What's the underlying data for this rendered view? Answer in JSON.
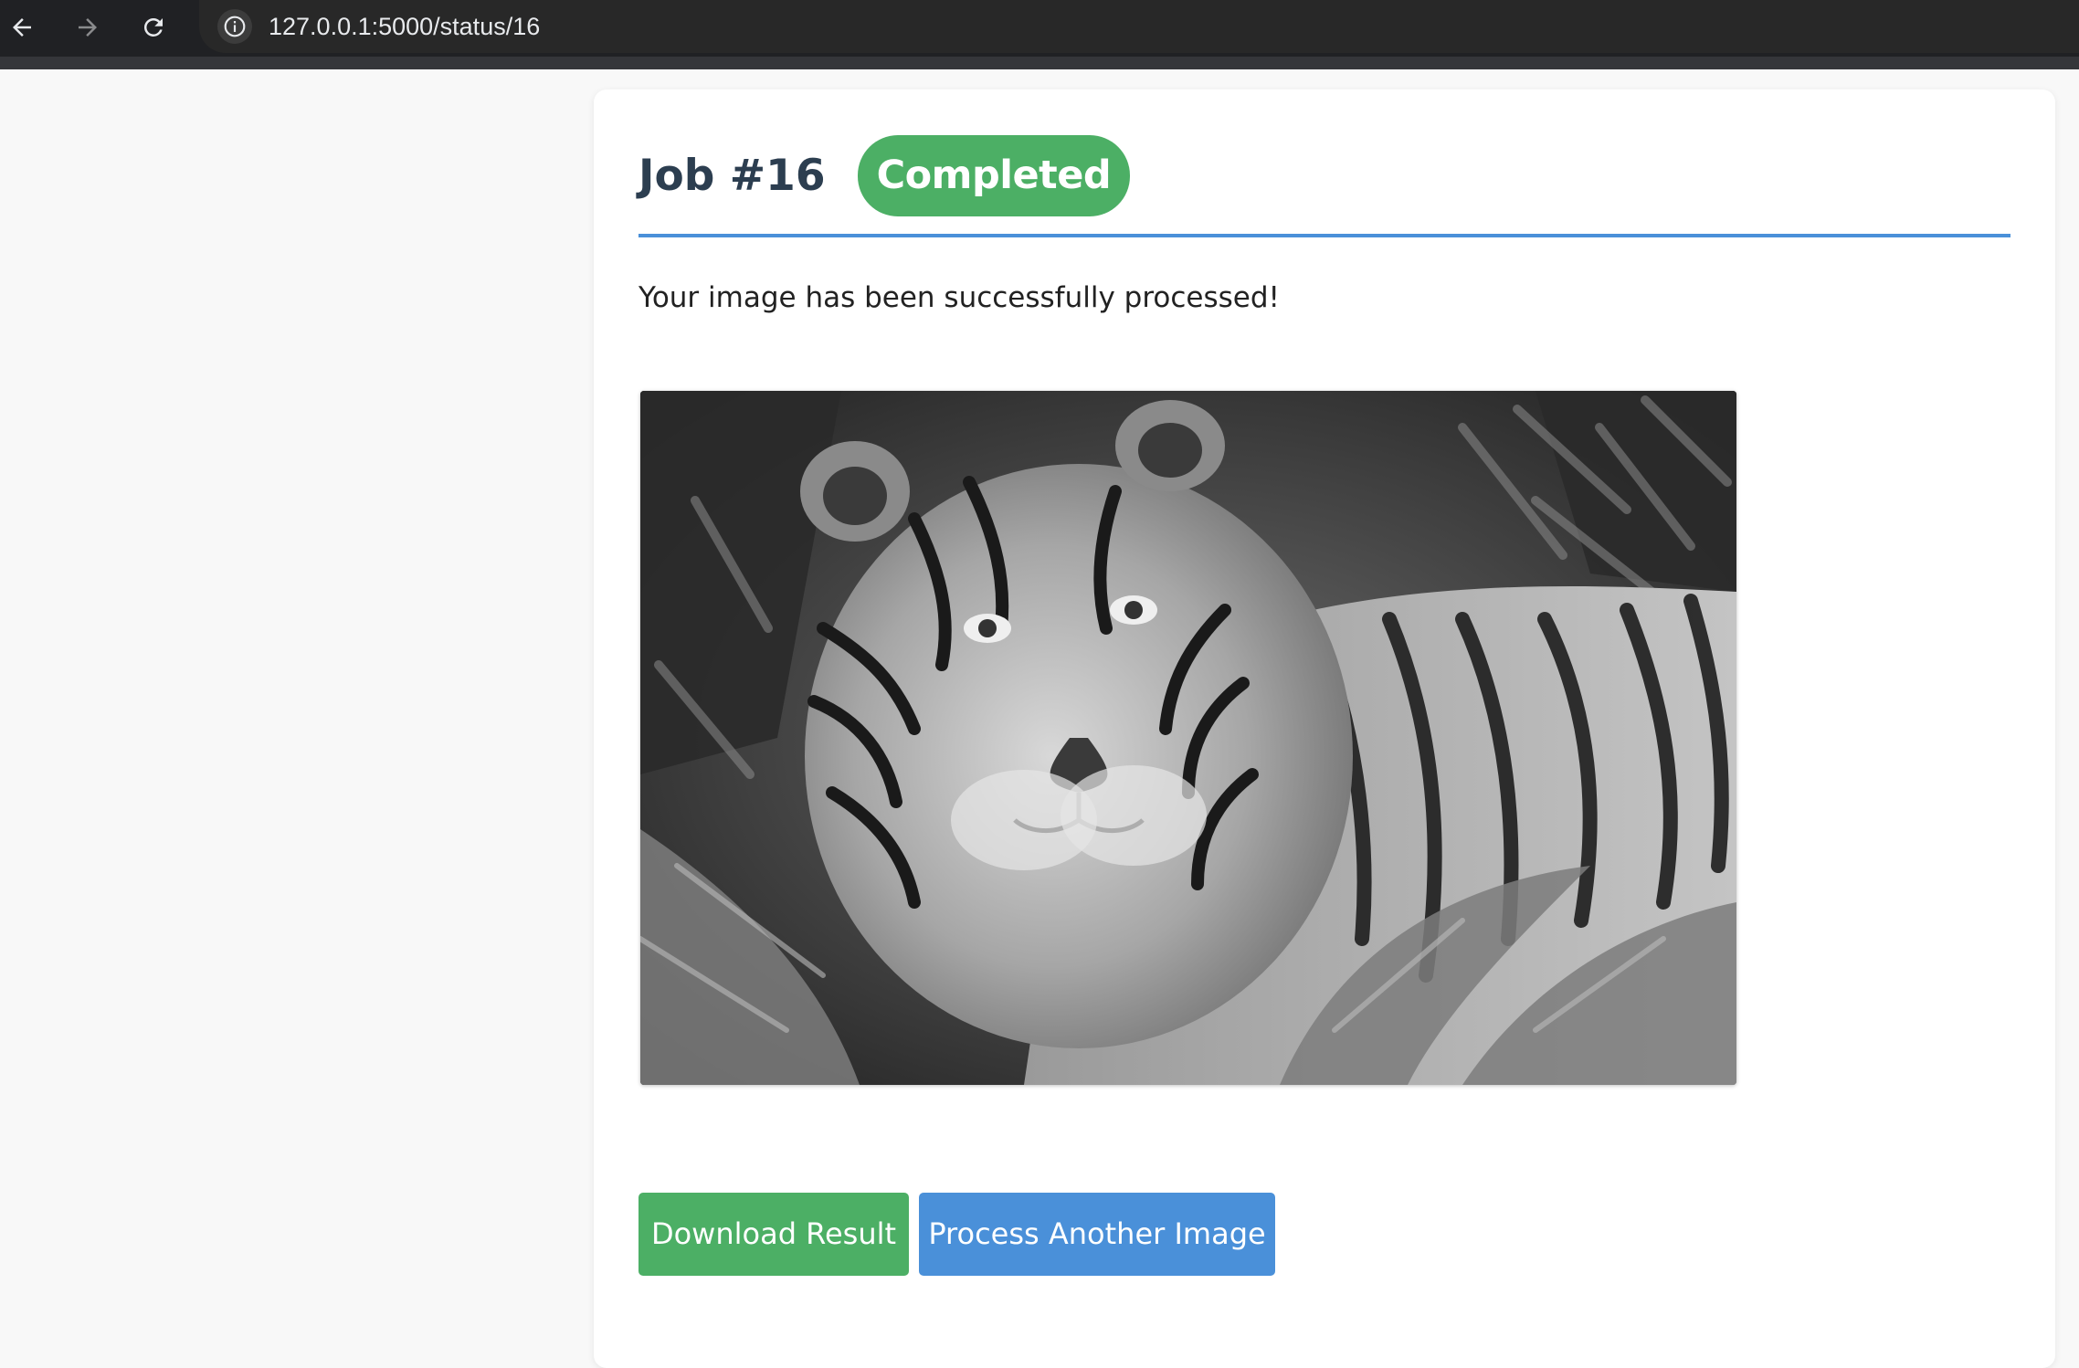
{
  "browser": {
    "url": "127.0.0.1:5000/status/16",
    "back_icon": "arrow-left-icon",
    "forward_icon": "arrow-right-icon",
    "reload_icon": "reload-icon",
    "info_icon": "info-icon"
  },
  "job": {
    "title": "Job #16",
    "status": "Completed",
    "message": "Your image has been successfully processed!",
    "image_description_icon": "grayscale-tiger-image"
  },
  "actions": {
    "download_label": "Download Result",
    "another_label": "Process Another Image"
  },
  "colors": {
    "success": "#4caf65",
    "primary": "#4a90d9",
    "title": "#2c3e50"
  }
}
